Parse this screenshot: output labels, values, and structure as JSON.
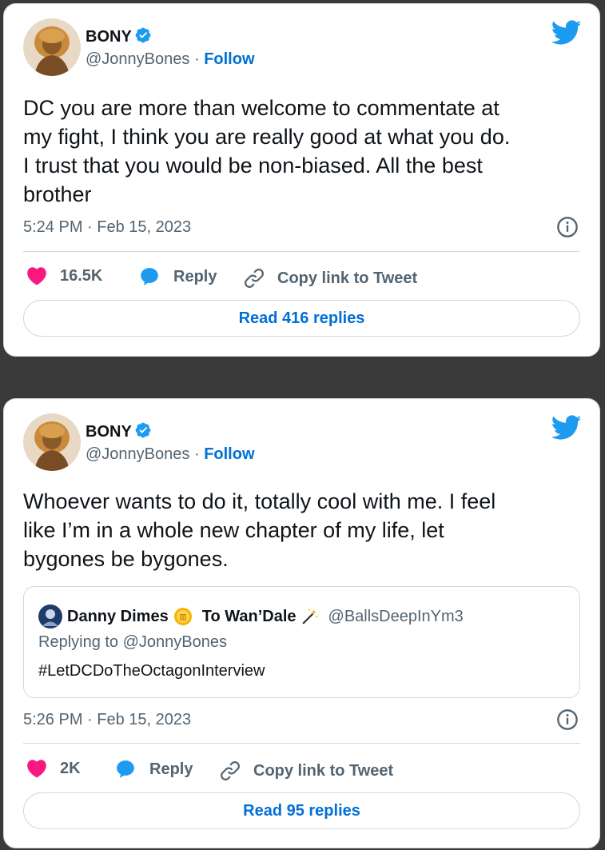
{
  "tweets": [
    {
      "author": {
        "name": "BONY",
        "handle": "@JonnyBones",
        "separator": "·",
        "follow_label": "Follow"
      },
      "text_lines": [
        "DC you are more than welcome to commentate at",
        "my fight, I think you are really good at what you do.",
        "I trust that you would be non-biased. All the best",
        "brother"
      ],
      "timestamp": "5:24 PM · Feb 15, 2023",
      "likes": "16.5K",
      "reply_label": "Reply",
      "copy_label": "Copy link to Tweet",
      "read_replies": "Read 416 replies"
    },
    {
      "author": {
        "name": "BONY",
        "handle": "@JonnyBones",
        "separator": "·",
        "follow_label": "Follow"
      },
      "text_lines": [
        "Whoever wants to do it, totally cool with me. I feel",
        "like I’m in a whole new chapter of my life, let",
        "bygones be bygones."
      ],
      "quoted": {
        "name_part1": "Danny Dimes",
        "name_part2": "To Wan’Dale",
        "handle": "@BallsDeepInYm3",
        "replying_to": "Replying to @JonnyBones",
        "text": "#LetDCDoTheOctagonInterview"
      },
      "timestamp": "5:26 PM · Feb 15, 2023",
      "likes": "2K",
      "reply_label": "Reply",
      "copy_label": "Copy link to Tweet",
      "read_replies": "Read 95 replies"
    }
  ],
  "colors": {
    "brand_blue": "#1d9bf0",
    "link_blue": "#006fd6",
    "heart_pink": "#f91880",
    "text_gray": "#536471"
  }
}
